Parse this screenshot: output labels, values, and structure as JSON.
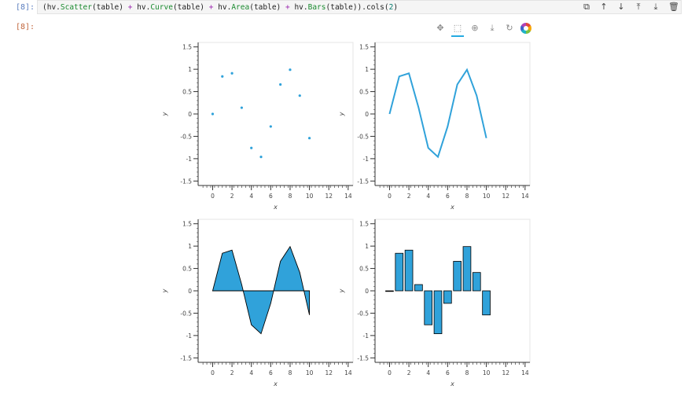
{
  "cell": {
    "in_prompt": "[8]:",
    "out_prompt": "[8]:",
    "code_tokens": [
      {
        "t": "(hv.",
        "c": ""
      },
      {
        "t": "Scatter",
        "c": "kw"
      },
      {
        "t": "(table) ",
        "c": ""
      },
      {
        "t": "+",
        "c": "op"
      },
      {
        "t": " hv.",
        "c": ""
      },
      {
        "t": "Curve",
        "c": "kw"
      },
      {
        "t": "(table) ",
        "c": ""
      },
      {
        "t": "+",
        "c": "op"
      },
      {
        "t": " hv.",
        "c": ""
      },
      {
        "t": "Area",
        "c": "kw"
      },
      {
        "t": "(table) ",
        "c": ""
      },
      {
        "t": "+",
        "c": "op"
      },
      {
        "t": " hv.",
        "c": ""
      },
      {
        "t": "Bars",
        "c": "kw"
      },
      {
        "t": "(table)).cols(",
        "c": ""
      },
      {
        "t": "2",
        "c": "num"
      },
      {
        "t": ")",
        "c": ""
      }
    ],
    "tools": [
      {
        "name": "duplicate-cell-icon",
        "glyph": "⧉"
      },
      {
        "name": "move-up-icon",
        "glyph": "↑"
      },
      {
        "name": "move-down-icon",
        "glyph": "↓"
      },
      {
        "name": "insert-above-icon",
        "glyph": "⤒"
      },
      {
        "name": "insert-below-icon",
        "glyph": "⤓"
      },
      {
        "name": "delete-cell-icon",
        "glyph": "🗑"
      }
    ]
  },
  "bokeh_toolbar": [
    {
      "name": "pan-tool-icon",
      "glyph": "✥",
      "active": false
    },
    {
      "name": "box-zoom-tool-icon",
      "glyph": "⬚",
      "active": true
    },
    {
      "name": "wheel-zoom-tool-icon",
      "glyph": "⊕",
      "active": false
    },
    {
      "name": "save-tool-icon",
      "glyph": "⤓",
      "active": false
    },
    {
      "name": "reset-tool-icon",
      "glyph": "↻",
      "active": false
    }
  ],
  "chart_data": [
    {
      "type": "scatter",
      "x": [
        0,
        1,
        2,
        3,
        4,
        5,
        6,
        7,
        8,
        9,
        10
      ],
      "y": [
        0,
        0.84,
        0.91,
        0.14,
        -0.76,
        -0.96,
        -0.28,
        0.66,
        0.99,
        0.41,
        -0.54
      ],
      "xlabel": "x",
      "ylabel": "y",
      "xlim": [
        -1.5,
        14.5
      ],
      "ylim": [
        -1.6,
        1.6
      ],
      "xticks": [
        0,
        2,
        4,
        6,
        8,
        10,
        12,
        14
      ],
      "yticks": [
        1.5,
        1,
        0.5,
        0,
        -0.5,
        -1,
        -1.5
      ],
      "color": "#30a2da"
    },
    {
      "type": "line",
      "x": [
        0,
        1,
        2,
        3,
        4,
        5,
        6,
        7,
        8,
        9,
        10
      ],
      "y": [
        0,
        0.84,
        0.91,
        0.14,
        -0.76,
        -0.96,
        -0.28,
        0.66,
        0.99,
        0.41,
        -0.54
      ],
      "xlabel": "x",
      "ylabel": "y",
      "xlim": [
        -1.5,
        14.5
      ],
      "ylim": [
        -1.6,
        1.6
      ],
      "xticks": [
        0,
        2,
        4,
        6,
        8,
        10,
        12,
        14
      ],
      "yticks": [
        1.5,
        1,
        0.5,
        0,
        -0.5,
        -1,
        -1.5
      ],
      "color": "#30a2da"
    },
    {
      "type": "area",
      "x": [
        0,
        1,
        2,
        3,
        4,
        5,
        6,
        7,
        8,
        9,
        10
      ],
      "y": [
        0,
        0.84,
        0.91,
        0.14,
        -0.76,
        -0.96,
        -0.28,
        0.66,
        0.99,
        0.41,
        -0.54
      ],
      "xlabel": "x",
      "ylabel": "y",
      "xlim": [
        -1.5,
        14.5
      ],
      "ylim": [
        -1.6,
        1.6
      ],
      "xticks": [
        0,
        2,
        4,
        6,
        8,
        10,
        12,
        14
      ],
      "yticks": [
        1.5,
        1,
        0.5,
        0,
        -0.5,
        -1,
        -1.5
      ],
      "color": "#30a2da"
    },
    {
      "type": "bar",
      "x": [
        0,
        1,
        2,
        3,
        4,
        5,
        6,
        7,
        8,
        9,
        10
      ],
      "y": [
        0,
        0.84,
        0.91,
        0.14,
        -0.76,
        -0.96,
        -0.28,
        0.66,
        0.99,
        0.41,
        -0.54
      ],
      "xlabel": "x",
      "ylabel": "y",
      "xlim": [
        -1.5,
        14.5
      ],
      "ylim": [
        -1.6,
        1.6
      ],
      "xticks": [
        0,
        2,
        4,
        6,
        8,
        10,
        12,
        14
      ],
      "yticks": [
        1.5,
        1,
        0.5,
        0,
        -0.5,
        -1,
        -1.5
      ],
      "color": "#30a2da"
    }
  ]
}
